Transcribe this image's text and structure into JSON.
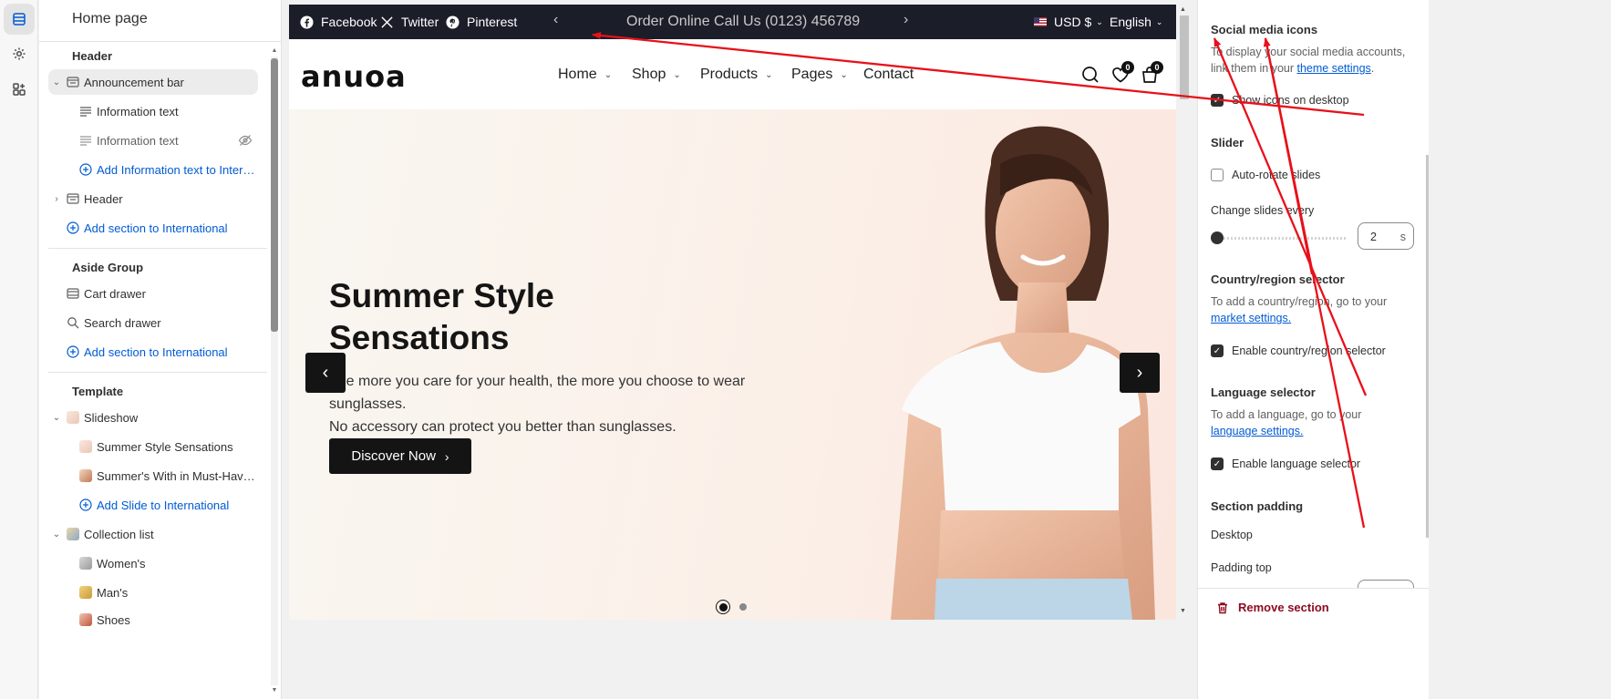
{
  "sidebar": {
    "title": "Home page",
    "groups": {
      "header": "Header",
      "aside": "Aside Group",
      "template": "Template"
    },
    "items": {
      "announcement_bar": "Announcement bar",
      "info_text_1": "Information text",
      "info_text_2": "Information text",
      "add_info_text": "Add Information text to Intern...",
      "header": "Header",
      "add_section_header": "Add section to International",
      "cart_drawer": "Cart drawer",
      "search_drawer": "Search drawer",
      "add_section_aside": "Add section to International",
      "slideshow": "Slideshow",
      "slide_1": "Summer Style Sensations",
      "slide_2": "Summer's With in Must-Have ...",
      "add_slide": "Add Slide to International",
      "collection_list": "Collection list",
      "womens": "Women's",
      "mans": "Man's",
      "shoes": "Shoes"
    }
  },
  "preview": {
    "announcement": {
      "social": [
        "Facebook",
        "Twitter",
        "Pinterest"
      ],
      "message": "Order Online Call Us (0123) 456789",
      "currency": "USD $",
      "language": "English"
    },
    "header": {
      "logo": "anuoa",
      "nav": [
        "Home",
        "Shop",
        "Products",
        "Pages",
        "Contact"
      ],
      "wishlist_count": "0",
      "cart_count": "0"
    },
    "hero": {
      "title_line1": "Summer Style",
      "title_line2": "Sensations",
      "subtitle_line1": "The more you care for your health, the more you choose to wear sunglasses.",
      "subtitle_line2": "No accessory can protect you better than sunglasses.",
      "button": "Discover Now"
    }
  },
  "panel": {
    "social_heading": "Social media icons",
    "social_text": "To display your social media accounts, link them in your",
    "social_link": "theme settings",
    "social_checkbox": "Show icons on desktop",
    "slider_heading": "Slider",
    "autorotate": "Auto-rotate slides",
    "change_every": "Change slides every",
    "change_value": "2",
    "change_unit": "s",
    "slider_level": 0,
    "country_heading": "Country/region selector",
    "country_text": "To add a country/region, go to your",
    "country_link": "market settings.",
    "country_checkbox": "Enable country/region selector",
    "language_heading": "Language selector",
    "language_text": "To add a language, go to your",
    "language_link": "language settings.",
    "language_checkbox": "Enable language selector",
    "padding_heading": "Section padding",
    "desktop": "Desktop",
    "padding_top": "Padding top",
    "remove": "Remove section"
  },
  "annotation_color": "#e8101a",
  "accent": "#005bd3"
}
